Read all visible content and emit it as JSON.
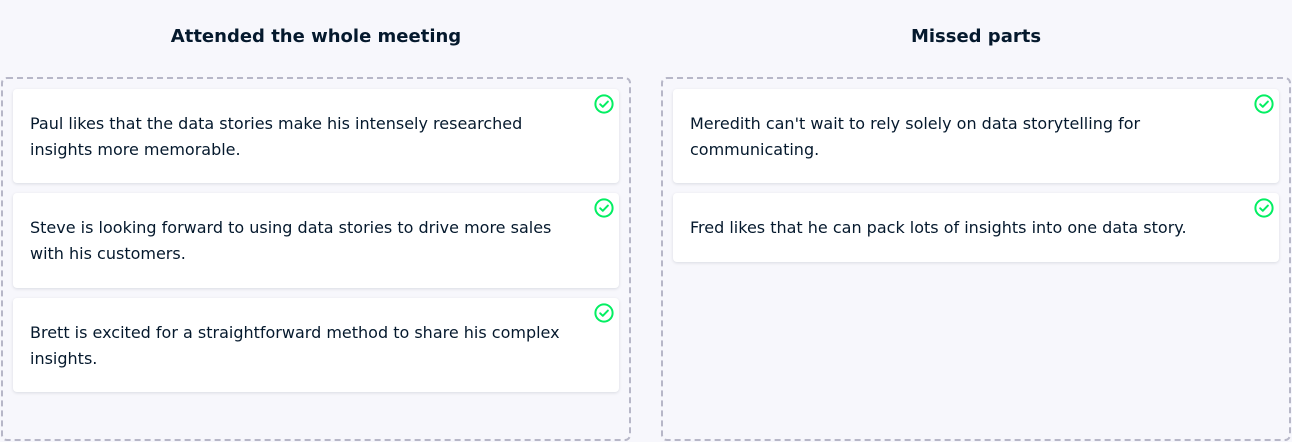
{
  "colors": {
    "background": "#f7f7fc",
    "text": "#05192d",
    "dashed_border": "#b7b7c8",
    "check_green": "#03ef62"
  },
  "columns": [
    {
      "title": "Attended the whole meeting",
      "cards": [
        {
          "text": "Paul likes that the data stories make his intensely researched insights more memorable.",
          "icon": "check-circle-icon"
        },
        {
          "text": "Steve is looking forward to using data stories to drive more sales with his customers.",
          "icon": "check-circle-icon"
        },
        {
          "text": "Brett is excited for a straightforward method to share his complex insights.",
          "icon": "check-circle-icon"
        }
      ]
    },
    {
      "title": "Missed parts",
      "cards": [
        {
          "text": "Meredith can't wait to rely solely on data storytelling for communicating.",
          "icon": "check-circle-icon"
        },
        {
          "text": "Fred likes that he can pack lots of insights into one data story.",
          "icon": "check-circle-icon"
        }
      ]
    }
  ]
}
